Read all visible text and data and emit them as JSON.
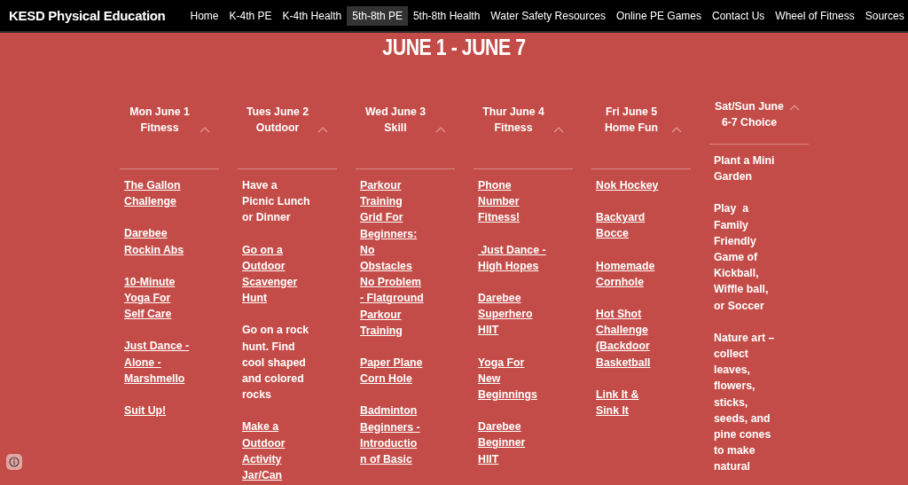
{
  "site_title": "KESD Physical Education",
  "nav": [
    {
      "label": "Home",
      "selected": false
    },
    {
      "label": "K-4th PE",
      "selected": false
    },
    {
      "label": "K-4th Health",
      "selected": false
    },
    {
      "label": "5th-8th PE",
      "selected": true
    },
    {
      "label": "5th-8th Health",
      "selected": false
    },
    {
      "label": "Water Safety Resources",
      "selected": false
    },
    {
      "label": "Online PE Games",
      "selected": false
    },
    {
      "label": "Contact Us",
      "selected": false
    },
    {
      "label": "Wheel of Fitness",
      "selected": false
    },
    {
      "label": "Sources",
      "selected": false
    }
  ],
  "week_title": "JUNE 1 - JUNE 7",
  "columns": [
    {
      "kind": "weekday",
      "heading": [
        "Mon June 1",
        "Fitness"
      ],
      "expanded": true,
      "items": [
        {
          "kind": "link",
          "lines": [
            "The Gallon",
            "Challenge"
          ]
        },
        {
          "kind": "link",
          "lines": [
            "Darebee",
            "Rockin Abs"
          ]
        },
        {
          "kind": "link",
          "lines": [
            "10-Minute",
            "Yoga For",
            "Self Care"
          ]
        },
        {
          "kind": "link",
          "lines": [
            "Just Dance -",
            "Alone -",
            "Marshmello"
          ]
        },
        {
          "kind": "link",
          "lines": [
            "Suit Up!"
          ]
        }
      ]
    },
    {
      "kind": "weekday",
      "heading": [
        "Tues June 2",
        "Outdoor"
      ],
      "expanded": true,
      "items": [
        {
          "kind": "text",
          "lines": [
            "Have a",
            "Picnic Lunch",
            "or Dinner"
          ]
        },
        {
          "kind": "link",
          "lines": [
            "Go on a",
            "Outdoor",
            "Scavenger",
            "Hunt"
          ]
        },
        {
          "kind": "text",
          "lines": [
            "Go on a rock",
            "hunt. Find",
            "cool shaped",
            "and colored",
            "rocks"
          ]
        },
        {
          "kind": "link",
          "lines": [
            "Make a",
            "Outdoor",
            "Activity",
            "Jar/Can"
          ]
        }
      ]
    },
    {
      "kind": "weekday",
      "heading": [
        "Wed June 3",
        "Skill"
      ],
      "expanded": true,
      "items": [
        {
          "kind": "link",
          "lines": [
            "Parkour",
            "Training",
            "Grid For",
            "Beginners:",
            "No",
            "Obstacles",
            "No Problem",
            "- Flatground",
            "Parkour",
            "Training"
          ]
        },
        {
          "kind": "link",
          "lines": [
            "Paper Plane",
            "Corn Hole"
          ]
        },
        {
          "kind": "link",
          "lines": [
            "Badminton",
            "Beginners -",
            "Introductio",
            "n of Basic"
          ]
        }
      ]
    },
    {
      "kind": "weekday",
      "heading": [
        "Thur June 4",
        "Fitness"
      ],
      "expanded": true,
      "items": [
        {
          "kind": "link",
          "lines": [
            "Phone",
            "Number",
            "Fitness!"
          ]
        },
        {
          "kind": "link",
          "lines": [
            " Just Dance -",
            "High Hopes"
          ]
        },
        {
          "kind": "link",
          "lines": [
            "Darebee",
            "Superhero",
            "HIIT"
          ]
        },
        {
          "kind": "link",
          "lines": [
            "Yoga For",
            "New",
            "Beginnings"
          ]
        },
        {
          "kind": "link",
          "lines": [
            "Darebee",
            "Beginner",
            "HIIT"
          ]
        }
      ]
    },
    {
      "kind": "weekday",
      "heading": [
        "Fri June 5",
        "Home Fun"
      ],
      "expanded": true,
      "items": [
        {
          "kind": "link",
          "lines": [
            "Nok Hockey"
          ]
        },
        {
          "kind": "link",
          "lines": [
            "Backyard",
            "Bocce"
          ]
        },
        {
          "kind": "link",
          "lines": [
            "Homemade",
            "Cornhole"
          ]
        },
        {
          "kind": "link",
          "lines": [
            "Hot Shot",
            "Challenge",
            "(Backdoor",
            "Basketball"
          ]
        },
        {
          "kind": "link",
          "lines": [
            "Link It &",
            "Sink It"
          ]
        }
      ]
    },
    {
      "kind": "weekend",
      "heading": [
        "Sat/Sun June",
        "6-7 Choice"
      ],
      "expanded": true,
      "items": [
        {
          "kind": "text",
          "lines": [
            "Plant a Mini",
            "Garden"
          ]
        },
        {
          "kind": "text",
          "lines": [
            "Play  a",
            "Family",
            "Friendly",
            "Game of",
            "Kickball,",
            "Wiffle ball,",
            "or Soccer"
          ]
        },
        {
          "kind": "text",
          "lines": [
            "Nature art –",
            "collect",
            "leaves,",
            "flowers,",
            "sticks,",
            "seeds, and",
            "pine cones",
            "to make",
            "natural"
          ]
        }
      ]
    }
  ]
}
